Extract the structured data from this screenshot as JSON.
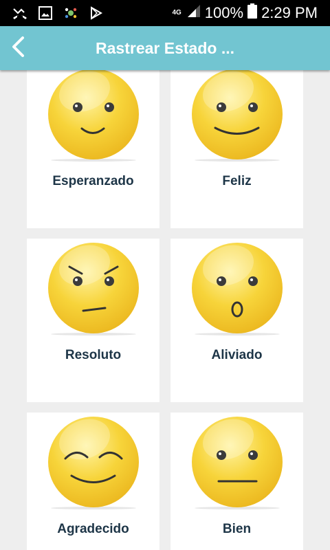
{
  "status_bar": {
    "network": "4G",
    "battery": "100%",
    "time": "2:29 PM"
  },
  "app_bar": {
    "title": "Rastrear Estado ...",
    "back_icon": "chevron-left-icon"
  },
  "moods": [
    {
      "label": "Esperanzado",
      "expression": "small-smile"
    },
    {
      "label": "Feliz",
      "expression": "wide-smile"
    },
    {
      "label": "Resoluto",
      "expression": "determined"
    },
    {
      "label": "Aliviado",
      "expression": "o-mouth"
    },
    {
      "label": "Agradecido",
      "expression": "closed-eyes-smile"
    },
    {
      "label": "Bien",
      "expression": "neutral"
    }
  ],
  "colors": {
    "app_bar": "#72c5d1",
    "background": "#eeeeee",
    "card": "#ffffff",
    "label": "#1d3547",
    "face": "#f6cd2f"
  }
}
